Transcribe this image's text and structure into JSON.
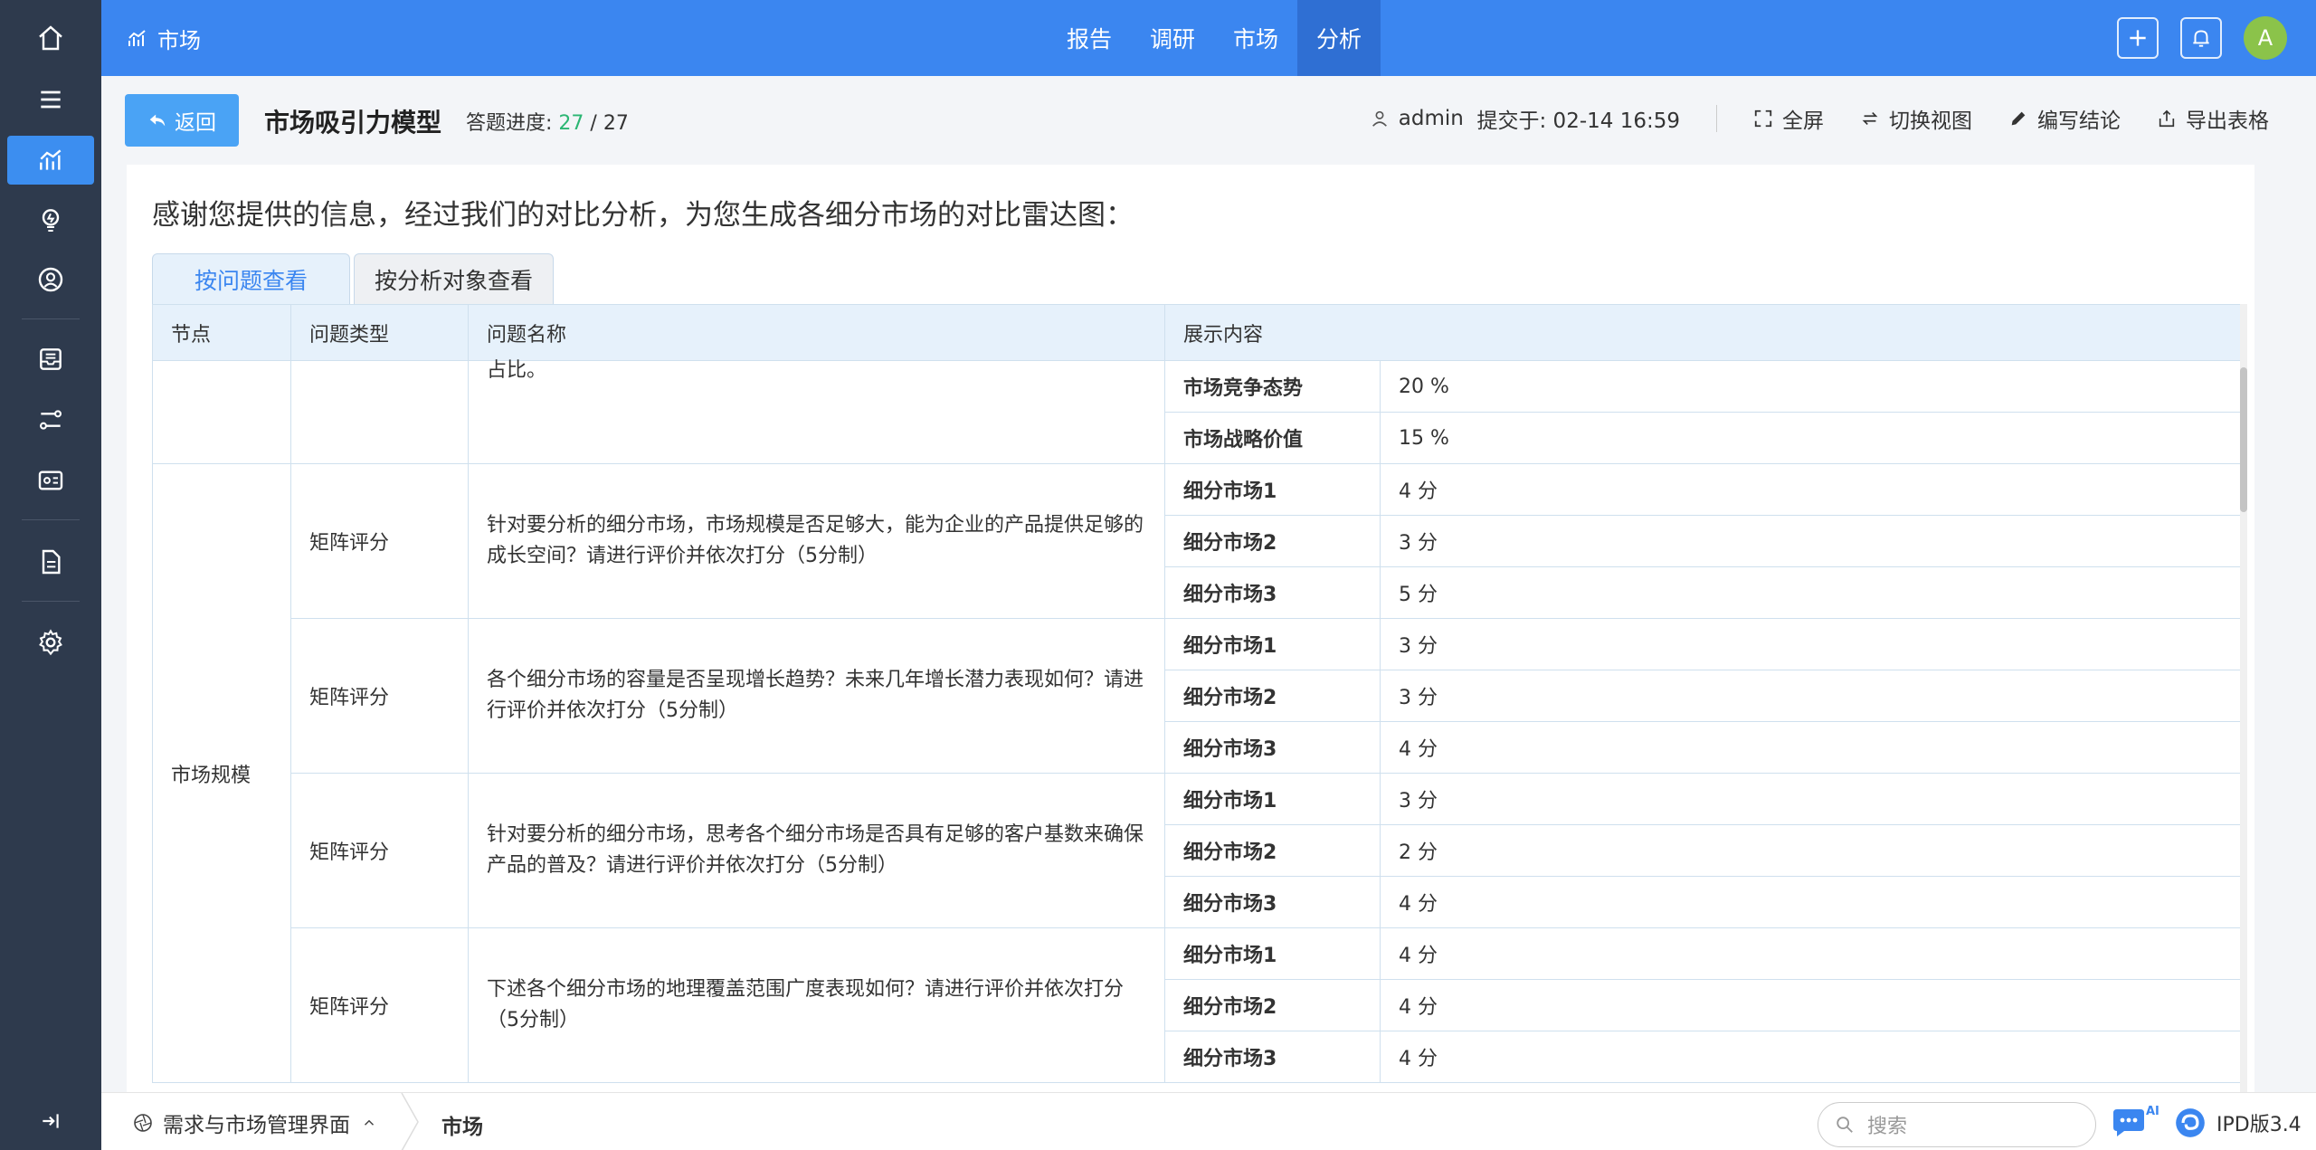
{
  "topbar": {
    "brand_label": "市场",
    "nav": [
      {
        "label": "报告",
        "active": false
      },
      {
        "label": "调研",
        "active": false
      },
      {
        "label": "市场",
        "active": false
      },
      {
        "label": "分析",
        "active": true
      }
    ],
    "avatar_letter": "A"
  },
  "sidebar": {
    "icons": [
      "home-icon",
      "menu-icon",
      "chart-icon",
      "lightbulb-icon",
      "user-circle-icon",
      "inbox-icon",
      "workflow-icon",
      "id-card-icon",
      "document-icon",
      "gear-icon"
    ],
    "active_index": 2
  },
  "header": {
    "back_label": "返回",
    "title": "市场吸引力模型",
    "progress_label": "答题进度:",
    "progress_current": "27",
    "progress_sep": " / ",
    "progress_total": "27",
    "user": "admin",
    "submitted": "提交于: 02-14 16:59",
    "fullscreen": "全屏",
    "switch_view": "切换视图",
    "write_conclusion": "编写结论",
    "export_table": "导出表格"
  },
  "content": {
    "intro": "感谢您提供的信息，经过我们的对比分析，为您生成各细分市场的对比雷达图：",
    "tabs": [
      {
        "label": "按问题查看",
        "active": true
      },
      {
        "label": "按分析对象查看",
        "active": false
      }
    ],
    "columns": [
      "节点",
      "问题类型",
      "问题名称",
      "展示内容"
    ],
    "partial_group": {
      "question_tail": "占比。",
      "rows": [
        {
          "label": "市场竞争态势",
          "value": "20 %"
        },
        {
          "label": "市场战略价值",
          "value": "15 %"
        }
      ]
    },
    "node_group": {
      "node": "市场规模",
      "questions": [
        {
          "type": "矩阵评分",
          "name": "针对要分析的细分市场，市场规模是否足够大，能为企业的产品提供足够的成长空间？请进行评价并依次打分（5分制）",
          "rows": [
            {
              "label": "细分市场1",
              "value": "4 分"
            },
            {
              "label": "细分市场2",
              "value": "3 分"
            },
            {
              "label": "细分市场3",
              "value": "5 分"
            }
          ]
        },
        {
          "type": "矩阵评分",
          "name": "各个细分市场的容量是否呈现增长趋势？未来几年增长潜力表现如何？请进行评价并依次打分（5分制）",
          "rows": [
            {
              "label": "细分市场1",
              "value": "3 分"
            },
            {
              "label": "细分市场2",
              "value": "3 分"
            },
            {
              "label": "细分市场3",
              "value": "4 分"
            }
          ]
        },
        {
          "type": "矩阵评分",
          "name": "针对要分析的细分市场，思考各个细分市场是否具有足够的客户基数来确保产品的普及？请进行评价并依次打分（5分制）",
          "rows": [
            {
              "label": "细分市场1",
              "value": "3 分"
            },
            {
              "label": "细分市场2",
              "value": "2 分"
            },
            {
              "label": "细分市场3",
              "value": "4 分"
            }
          ]
        },
        {
          "type": "矩阵评分",
          "name": "下述各个细分市场的地理覆盖范围广度表现如何？请进行评价并依次打分（5分制）",
          "rows": [
            {
              "label": "细分市场1",
              "value": "4 分"
            },
            {
              "label": "细分市场2",
              "value": "4 分"
            },
            {
              "label": "细分市场3",
              "value": "4 分"
            }
          ]
        }
      ]
    }
  },
  "bottombar": {
    "module": "需求与市场管理界面",
    "crumb": "市场",
    "search_placeholder": "搜索",
    "ai_badge": "AI",
    "version": "IPD版3.4"
  }
}
